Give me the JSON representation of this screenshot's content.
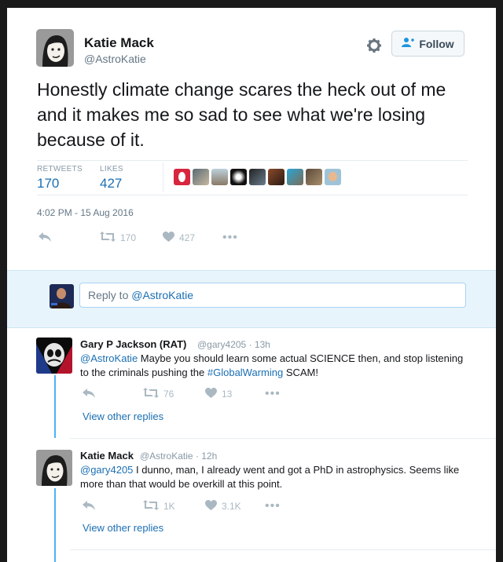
{
  "tweet": {
    "author_name": "Katie Mack",
    "author_handle": "@AstroKatie",
    "follow_label": "Follow",
    "text": "Honestly climate change scares the heck out of me and it makes me so sad to see what we're losing because of it.",
    "retweets_label": "RETWEETS",
    "retweets_value": "170",
    "likes_label": "LIKES",
    "likes_value": "427",
    "timestamp": "4:02 PM - 15 Aug 2016",
    "action_retweet_count": "170",
    "action_like_count": "427"
  },
  "reply_box": {
    "prefix": "Reply to ",
    "mention": "@AstroKatie"
  },
  "replies": [
    {
      "name": "Gary P Jackson (RAT)",
      "handle": "@gary4205",
      "time": "13h",
      "mention": "@AstroKatie",
      "text_a": " Maybe you should learn some actual SCIENCE then, and stop listening to the criminals pushing the ",
      "hashtag": "#GlobalWarming",
      "text_b": " SCAM!",
      "retweets": "76",
      "likes": "13",
      "view_other": "View other replies"
    },
    {
      "name": "Katie Mack",
      "handle": "@AstroKatie",
      "time": "12h",
      "mention": "@gary4205",
      "text_a": " I dunno, man, I already went and got a PhD in astrophysics. Seems like more than that would be overkill at this point.",
      "retweets": "1K",
      "likes": "3.1K",
      "view_other": "View other replies"
    }
  ],
  "colors": {
    "accent": "#1b6fb3",
    "reply_band": "#e8f4fb",
    "thread_line": "#4ab3f4",
    "muted": "#8899a6"
  },
  "icons": [
    "gear-icon",
    "follow-person-icon",
    "reply-icon",
    "retweet-icon",
    "heart-icon",
    "more-icon"
  ]
}
